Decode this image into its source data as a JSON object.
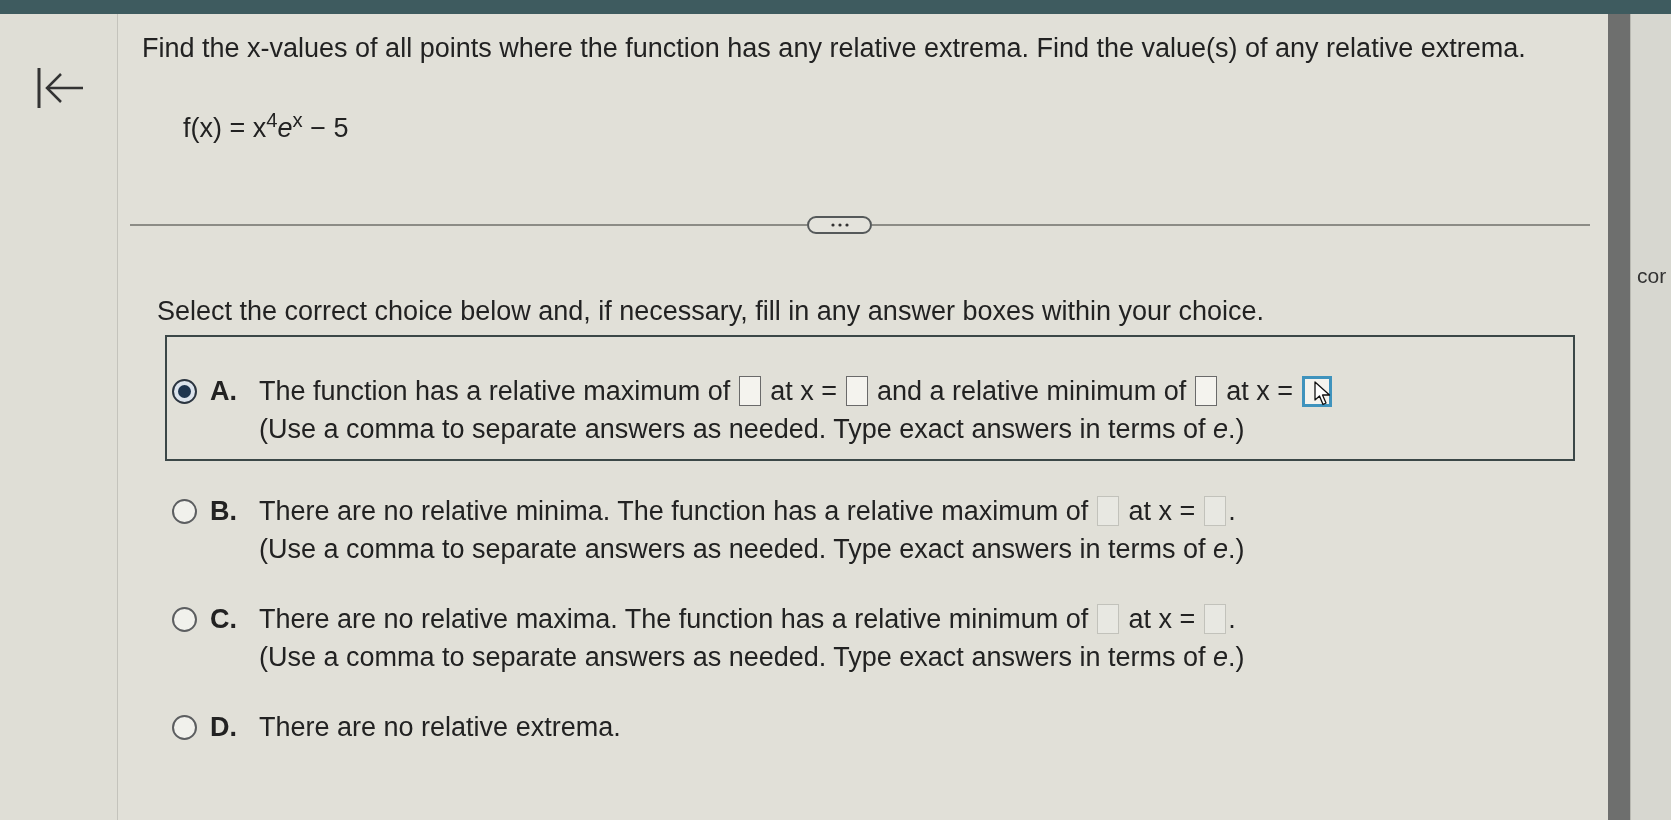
{
  "question": {
    "prompt": "Find the x-values of all points where the function has any relative extrema. Find the value(s) of any relative extrema.",
    "function": "f(x) = x$^{4}$*e*$^{x}$ − 5"
  },
  "instruction": "Select the correct choice below and, if necessary, fill in any answer boxes within your choice.",
  "choices": [
    {
      "letter": "A.",
      "selected": true,
      "line": [
        {
          "kind": "text",
          "text": "The function has a relative maximum of"
        },
        {
          "kind": "field",
          "focused": false
        },
        {
          "kind": "text",
          "text": "at x ="
        },
        {
          "kind": "field",
          "focused": false
        },
        {
          "kind": "text",
          "text": "and a relative minimum of"
        },
        {
          "kind": "field",
          "focused": false
        },
        {
          "kind": "text",
          "text": "at x ="
        },
        {
          "kind": "field",
          "focused": true
        }
      ],
      "note": "(Use a comma to separate answers as needed. Type exact answers in terms of *e*.)"
    },
    {
      "letter": "B.",
      "selected": false,
      "line": [
        {
          "kind": "text",
          "text": "There are no relative minima. The function has a relative maximum of"
        },
        {
          "kind": "field",
          "focused": false
        },
        {
          "kind": "text",
          "text": "at x ="
        },
        {
          "kind": "field",
          "focused": false
        },
        {
          "kind": "suffix",
          "text": "."
        }
      ],
      "note": "(Use a comma to separate answers as needed. Type exact answers in terms of *e*.)"
    },
    {
      "letter": "C.",
      "selected": false,
      "line": [
        {
          "kind": "text",
          "text": "There are no relative maxima. The function has a relative minimum of"
        },
        {
          "kind": "field",
          "focused": false
        },
        {
          "kind": "text",
          "text": "at x ="
        },
        {
          "kind": "field",
          "focused": false
        },
        {
          "kind": "suffix",
          "text": "."
        }
      ],
      "note": "(Use a comma to separate answers as needed. Type exact answers in terms of *e*.)"
    },
    {
      "letter": "D.",
      "selected": false,
      "line": [
        {
          "kind": "text",
          "text": "There are no relative extrema."
        }
      ]
    }
  ],
  "side_panel": {
    "text": "cor"
  }
}
